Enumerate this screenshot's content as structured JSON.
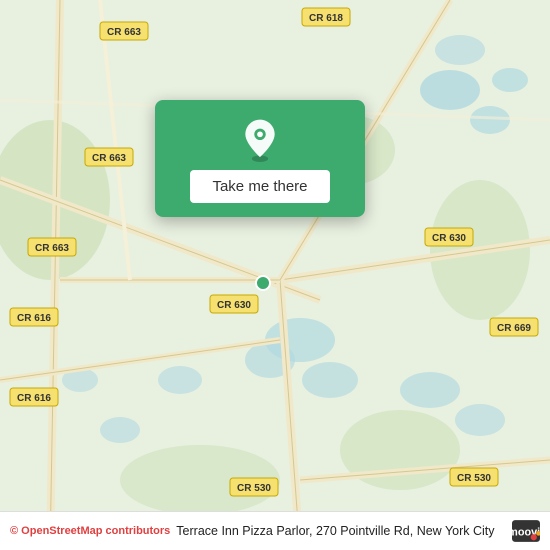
{
  "map": {
    "background_color": "#e8f0e0",
    "attribution": "© OpenStreetMap contributors"
  },
  "popup": {
    "button_label": "Take me there",
    "green_color": "#3daa6e"
  },
  "bottom_bar": {
    "address": "Terrace Inn Pizza Parlor, 270 Pointville Rd, New York City",
    "osm_text": "© OpenStreetMap contributors",
    "moovit_label": "moovit"
  },
  "road_labels": [
    "CR 663",
    "CR 663",
    "CR 663",
    "CR 618",
    "CR 616",
    "CR 616",
    "CR 630",
    "CR 630",
    "CR 669",
    "CR 530",
    "CR 530"
  ],
  "icons": {
    "location_pin": "📍",
    "moovit_colors": [
      "#e04040",
      "#f5a623",
      "#333"
    ]
  }
}
